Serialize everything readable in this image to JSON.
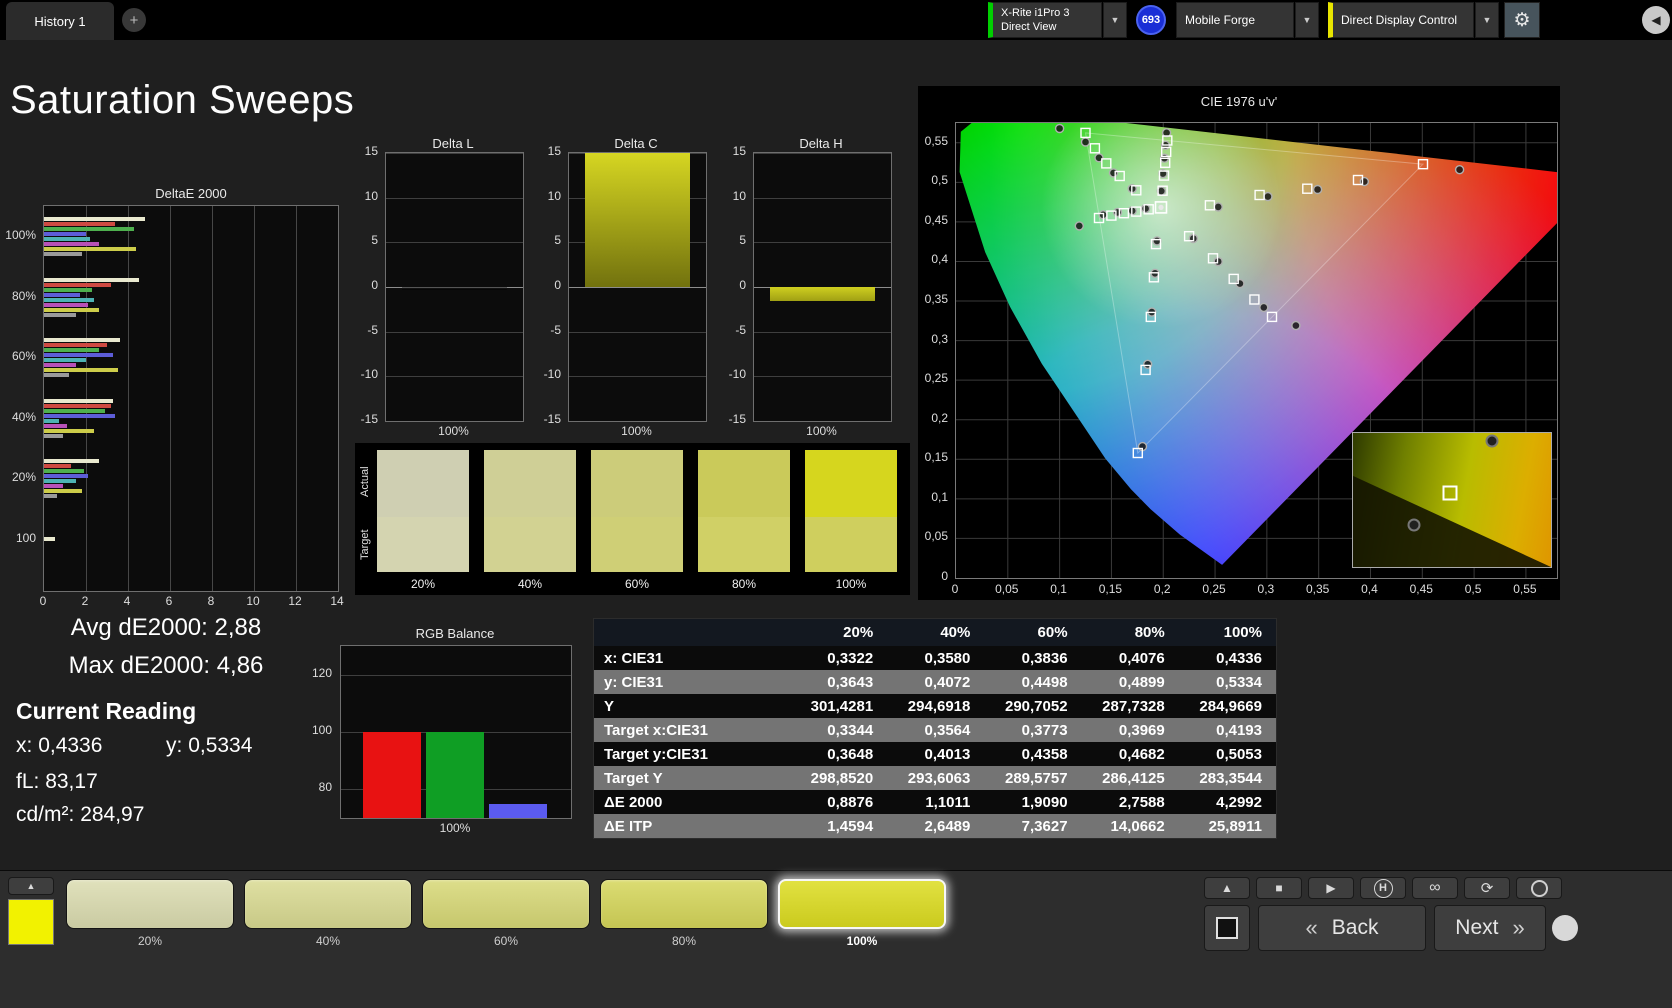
{
  "title": "Saturation Sweeps",
  "icons": {
    "dropdown": "▼",
    "gear": "⚙",
    "panel_toggle": "◀",
    "collapse": "▲",
    "stop": "■",
    "play": "▶",
    "history_letter": "H",
    "loop": "∞",
    "refresh": "⟳",
    "back_chevrons": "«",
    "next_chevrons": "»"
  },
  "top_bar": {
    "tab_label": "History 1",
    "add_tab_label": "+",
    "meter_line1": "X-Rite i1Pro 3",
    "meter_line2": "Direct View",
    "meter_accent": "#00cf00",
    "count_badge": "693",
    "source_label": "Mobile Forge",
    "display_control_label": "Direct Display Control",
    "display_control_accent": "#e8e500"
  },
  "readout": {
    "avg": {
      "label": "Avg dE2000:",
      "value": "2,88"
    },
    "max": {
      "label": "Max dE2000:",
      "value": "4,86"
    },
    "title": "Current Reading",
    "x": {
      "label": "x:",
      "value": "0,4336"
    },
    "y": {
      "label": "y:",
      "value": "0,5334"
    },
    "fl": {
      "label": "fL:",
      "value": "83,17"
    },
    "cdm2": {
      "label": "cd/m²:",
      "value": "284,97"
    }
  },
  "swatch_strip": {
    "row_labels": [
      "Actual",
      "Target"
    ],
    "levels": [
      "20%",
      "40%",
      "60%",
      "80%",
      "100%"
    ],
    "actual": [
      "#cfcfb2",
      "#cfcf96",
      "#cccc7a",
      "#caca5a",
      "#d6d61e"
    ],
    "target": [
      "#d4d4b0",
      "#d2d292",
      "#cfcf76",
      "#d0d066",
      "#cfcf5e"
    ]
  },
  "bottom_bar": {
    "current_swatch_color": "#f2f200",
    "patches": [
      {
        "label": "20%",
        "color": "#dbdcb0",
        "selected": false
      },
      {
        "label": "40%",
        "color": "#d9da92",
        "selected": false
      },
      {
        "label": "60%",
        "color": "#d7d876",
        "selected": false
      },
      {
        "label": "80%",
        "color": "#d5d65a",
        "selected": false
      },
      {
        "label": "100%",
        "color": "#dcdc20",
        "selected": true
      }
    ],
    "back_label": "Back",
    "next_label": "Next"
  },
  "chart_data": [
    {
      "id": "deltae2000",
      "type": "bar",
      "orientation": "horizontal",
      "title": "DeltaE 2000",
      "xlim": [
        0,
        14
      ],
      "xticks": [
        0,
        2,
        4,
        6,
        8,
        10,
        12,
        14
      ],
      "xtick_labels": [
        "0",
        "2",
        "4",
        "6",
        "8",
        "10",
        "12",
        "14"
      ],
      "categories": [
        "100%",
        "80%",
        "60%",
        "40%",
        "20%",
        "100"
      ],
      "series_colors": [
        "#e9e9cf",
        "#cf4a42",
        "#4eb04e",
        "#5d5dd8",
        "#4db3b3",
        "#b751b7",
        "#cdcd4a",
        "#9a9a9a"
      ],
      "groups": [
        [
          4.8,
          3.4,
          4.3,
          2.0,
          2.2,
          2.6,
          4.4,
          1.8
        ],
        [
          4.5,
          3.2,
          2.3,
          1.7,
          2.4,
          2.1,
          2.6,
          1.5
        ],
        [
          3.6,
          3.0,
          2.6,
          3.3,
          2.0,
          1.5,
          3.5,
          1.2
        ],
        [
          3.3,
          3.2,
          2.9,
          3.4,
          0.7,
          1.1,
          2.4,
          0.9
        ],
        [
          2.6,
          1.3,
          1.9,
          2.1,
          1.5,
          0.9,
          1.8,
          0.6
        ],
        [
          0.5
        ]
      ]
    },
    {
      "id": "delta_l",
      "type": "bar",
      "title": "Delta L",
      "value": -0.2,
      "ylim": [
        -15,
        15
      ],
      "ytick_labels": [
        "15",
        "10",
        "5",
        "0",
        "-5",
        "-10",
        "-15"
      ],
      "xlabel": "100%",
      "bar_colors": [
        "#161616",
        "#000000"
      ]
    },
    {
      "id": "delta_c",
      "type": "bar",
      "title": "Delta C",
      "value": 15,
      "ylim": [
        -15,
        15
      ],
      "ytick_labels": [
        "15",
        "10",
        "5",
        "0",
        "-5",
        "-10",
        "-15"
      ],
      "xlabel": "100%",
      "bar_colors": [
        "#d6d622",
        "#72720e"
      ]
    },
    {
      "id": "delta_h",
      "type": "bar",
      "title": "Delta H",
      "value": -1.6,
      "ylim": [
        -15,
        15
      ],
      "ytick_labels": [
        "15",
        "10",
        "5",
        "0",
        "-5",
        "-10",
        "-15"
      ],
      "xlabel": "100%",
      "bar_colors": [
        "#cfcf20",
        "#a0a014"
      ]
    },
    {
      "id": "rgb_balance",
      "type": "bar",
      "title": "RGB Balance",
      "categories": [
        "Red",
        "Green",
        "Blue"
      ],
      "values": [
        100,
        100,
        74.8
      ],
      "colors": [
        "#e81212",
        "#0f9e24",
        "#5b5bf0"
      ],
      "ylim": [
        70,
        130
      ],
      "yticks": [
        120,
        100,
        80
      ],
      "ytick_labels": [
        "120",
        "100",
        "80"
      ],
      "xlabel": "100%"
    },
    {
      "id": "cie_1976",
      "type": "scatter",
      "title": "CIE 1976 u'v'",
      "xlim": [
        0,
        0.58
      ],
      "ylim": [
        0,
        0.575
      ],
      "tick_step": 0.05,
      "xtick_labels": [
        "0",
        "0,05",
        "0,1",
        "0,15",
        "0,2",
        "0,25",
        "0,3",
        "0,35",
        "0,4",
        "0,45",
        "0,5",
        "0,55"
      ],
      "ytick_labels": [
        "0",
        "0,05",
        "0,1",
        "0,15",
        "0,2",
        "0,25",
        "0,3",
        "0,35",
        "0,4",
        "0,45",
        "0,5",
        "0,55"
      ],
      "locus": [
        [
          0.2568,
          0.0166
        ],
        [
          0.2161,
          0.0549
        ],
        [
          0.1877,
          0.0871
        ],
        [
          0.169,
          0.112
        ],
        [
          0.1441,
          0.151
        ],
        [
          0.0828,
          0.2708
        ],
        [
          0.0521,
          0.3427
        ],
        [
          0.0282,
          0.4117
        ],
        [
          0.0035,
          0.5131
        ],
        [
          0.0046,
          0.5639
        ],
        [
          0.0231,
          0.5837
        ],
        [
          0.05,
          0.5868
        ],
        [
          0.0792,
          0.5856
        ],
        [
          0.1127,
          0.5821
        ],
        [
          0.1531,
          0.5766
        ],
        [
          0.2623,
          0.5605
        ],
        [
          0.3315,
          0.5501
        ],
        [
          0.4035,
          0.5393
        ],
        [
          0.5202,
          0.5219
        ],
        [
          0.6234,
          0.5065
        ]
      ],
      "triangle": [
        [
          0.125,
          0.5625
        ],
        [
          0.4507,
          0.5229
        ],
        [
          0.1754,
          0.1579
        ]
      ],
      "white_point": [
        0.1978,
        0.4683
      ],
      "sweeps": [
        {
          "name": "red",
          "targets": [
            [
              0.245,
              0.471
            ],
            [
              0.293,
              0.484
            ],
            [
              0.339,
              0.492
            ],
            [
              0.388,
              0.503
            ],
            [
              0.4507,
              0.5229
            ]
          ],
          "measured": [
            [
              0.253,
              0.469
            ],
            [
              0.301,
              0.482
            ],
            [
              0.349,
              0.491
            ],
            [
              0.394,
              0.501
            ],
            [
              0.486,
              0.516
            ]
          ]
        },
        {
          "name": "green",
          "targets": [
            [
              0.174,
              0.49
            ],
            [
              0.158,
              0.508
            ],
            [
              0.145,
              0.524
            ],
            [
              0.134,
              0.543
            ],
            [
              0.125,
              0.5625
            ]
          ],
          "measured": [
            [
              0.17,
              0.492
            ],
            [
              0.152,
              0.512
            ],
            [
              0.138,
              0.531
            ],
            [
              0.125,
              0.551
            ],
            [
              0.1,
              0.568
            ]
          ]
        },
        {
          "name": "blue",
          "targets": [
            [
              0.193,
              0.422
            ],
            [
              0.191,
              0.38
            ],
            [
              0.188,
              0.33
            ],
            [
              0.183,
              0.263
            ],
            [
              0.1754,
              0.158
            ]
          ],
          "measured": [
            [
              0.194,
              0.426
            ],
            [
              0.192,
              0.385
            ],
            [
              0.189,
              0.336
            ],
            [
              0.185,
              0.27
            ],
            [
              0.18,
              0.166
            ]
          ]
        },
        {
          "name": "cyan",
          "targets": [
            [
              0.186,
              0.466
            ],
            [
              0.174,
              0.463
            ],
            [
              0.162,
              0.461
            ],
            [
              0.15,
              0.458
            ],
            [
              0.138,
              0.455
            ]
          ],
          "measured": [
            [
              0.183,
              0.467
            ],
            [
              0.17,
              0.464
            ],
            [
              0.156,
              0.462
            ],
            [
              0.142,
              0.459
            ],
            [
              0.119,
              0.445
            ]
          ]
        },
        {
          "name": "magenta",
          "targets": [
            [
              0.225,
              0.432
            ],
            [
              0.248,
              0.404
            ],
            [
              0.268,
              0.378
            ],
            [
              0.288,
              0.352
            ],
            [
              0.305,
              0.33
            ]
          ],
          "measured": [
            [
              0.229,
              0.429
            ],
            [
              0.253,
              0.4
            ],
            [
              0.274,
              0.372
            ],
            [
              0.297,
              0.342
            ],
            [
              0.328,
              0.319
            ]
          ]
        },
        {
          "name": "yellow",
          "targets": [
            [
              0.1994,
              0.4894
            ],
            [
              0.2007,
              0.5085
            ],
            [
              0.2019,
              0.5247
            ],
            [
              0.2029,
              0.5385
            ],
            [
              0.2039,
              0.5529
            ]
          ],
          "measured": [
            [
              0.1981,
              0.4889
            ],
            [
              0.1997,
              0.5111
            ],
            [
              0.2011,
              0.5305
            ],
            [
              0.2022,
              0.5468
            ],
            [
              0.2032,
              0.5626
            ]
          ]
        }
      ],
      "inset": {
        "square": [
          0.49,
          0.45
        ],
        "circles": [
          [
            0.7,
            0.06
          ],
          [
            0.31,
            0.69
          ]
        ]
      }
    },
    {
      "id": "measurement_table",
      "type": "table",
      "columns": [
        "",
        "20%",
        "40%",
        "60%",
        "80%",
        "100%"
      ],
      "rows": [
        {
          "label": "x: CIE31",
          "values": [
            "0,3322",
            "0,3580",
            "0,3836",
            "0,4076",
            "0,4336"
          ]
        },
        {
          "label": "y: CIE31",
          "values": [
            "0,3643",
            "0,4072",
            "0,4498",
            "0,4899",
            "0,5334"
          ]
        },
        {
          "label": "Y",
          "values": [
            "301,4281",
            "294,6918",
            "290,7052",
            "287,7328",
            "284,9669"
          ]
        },
        {
          "label": "Target x:CIE31",
          "values": [
            "0,3344",
            "0,3564",
            "0,3773",
            "0,3969",
            "0,4193"
          ]
        },
        {
          "label": "Target y:CIE31",
          "values": [
            "0,3648",
            "0,4013",
            "0,4358",
            "0,4682",
            "0,5053"
          ]
        },
        {
          "label": "Target Y",
          "values": [
            "298,8520",
            "293,6063",
            "289,5757",
            "286,4125",
            "283,3544"
          ]
        },
        {
          "label": "ΔE 2000",
          "values": [
            "0,8876",
            "1,1011",
            "1,9090",
            "2,7588",
            "4,2992"
          ]
        },
        {
          "label": "ΔE ITP",
          "values": [
            "1,4594",
            "2,6489",
            "7,3627",
            "14,0662",
            "25,8911"
          ]
        }
      ]
    }
  ]
}
